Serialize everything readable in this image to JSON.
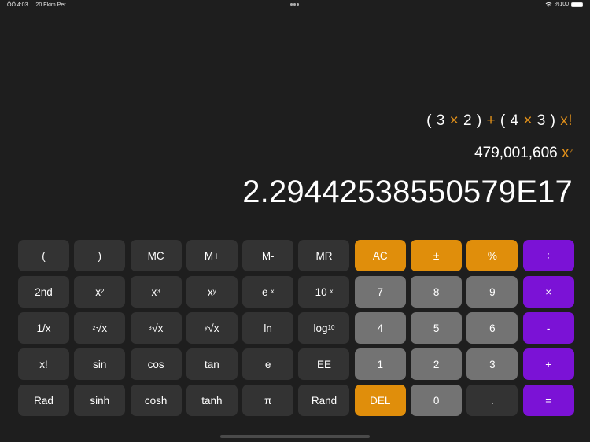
{
  "status_bar": {
    "time": "ÖÖ 4:03",
    "date": "20 Ekim Per",
    "battery_text": "%100",
    "battery_level": 1.0
  },
  "display": {
    "expression": [
      {
        "t": "(",
        "op": false
      },
      {
        "t": "3",
        "op": false
      },
      {
        "t": "×",
        "op": true
      },
      {
        "t": "2",
        "op": false
      },
      {
        "t": ")",
        "op": false
      },
      {
        "t": "+",
        "op": true
      },
      {
        "t": "(",
        "op": false
      },
      {
        "t": "4",
        "op": false
      },
      {
        "t": "×",
        "op": true
      },
      {
        "t": "3",
        "op": false
      },
      {
        "t": ")",
        "op": false
      },
      {
        "t": "x!",
        "op": true
      }
    ],
    "previous_value": "479,001,606",
    "previous_op_base": "x",
    "previous_op_sup": "2",
    "result": "2.29442538550579E17"
  },
  "keys": {
    "open_paren": "(",
    "close_paren": ")",
    "mc": "MC",
    "m_plus": "M+",
    "m_minus": "M-",
    "mr": "MR",
    "ac": "AC",
    "plus_minus": "±",
    "percent": "%",
    "divide": "÷",
    "second": "2nd",
    "x_squared_base": "x",
    "x_squared_sup": "2",
    "x_cubed_base": "x",
    "x_cubed_sup": "3",
    "x_pow_y_base": "x",
    "x_pow_y_sup": "y",
    "e_pow_x_base": "e",
    "e_pow_x_sup": "x",
    "ten_pow_x_base": "10",
    "ten_pow_x_sup": "x",
    "seven": "7",
    "eight": "8",
    "nine": "9",
    "multiply": "×",
    "reciprocal": "1/x",
    "sqrt_pre": "2",
    "sqrt_body": "√x",
    "cbrt_pre": "3",
    "cbrt_body": "√x",
    "yroot_pre": "y",
    "yroot_body": "√x",
    "ln": "ln",
    "log10_base": "log",
    "log10_sub": "10",
    "four": "4",
    "five": "5",
    "six": "6",
    "minus": "-",
    "factorial": "x!",
    "sin": "sin",
    "cos": "cos",
    "tan": "tan",
    "e": "e",
    "ee": "EE",
    "one": "1",
    "two": "2",
    "three": "3",
    "plus": "+",
    "rad": "Rad",
    "sinh": "sinh",
    "cosh": "cosh",
    "tanh": "tanh",
    "pi": "π",
    "rand": "Rand",
    "del": "DEL",
    "zero": "0",
    "decimal": ".",
    "equals": "="
  },
  "colors": {
    "background": "#1e1e1e",
    "function_key": "#333333",
    "digit_key": "#737373",
    "accent_orange": "#e08e0b",
    "operator_purple": "#7b12d6"
  }
}
